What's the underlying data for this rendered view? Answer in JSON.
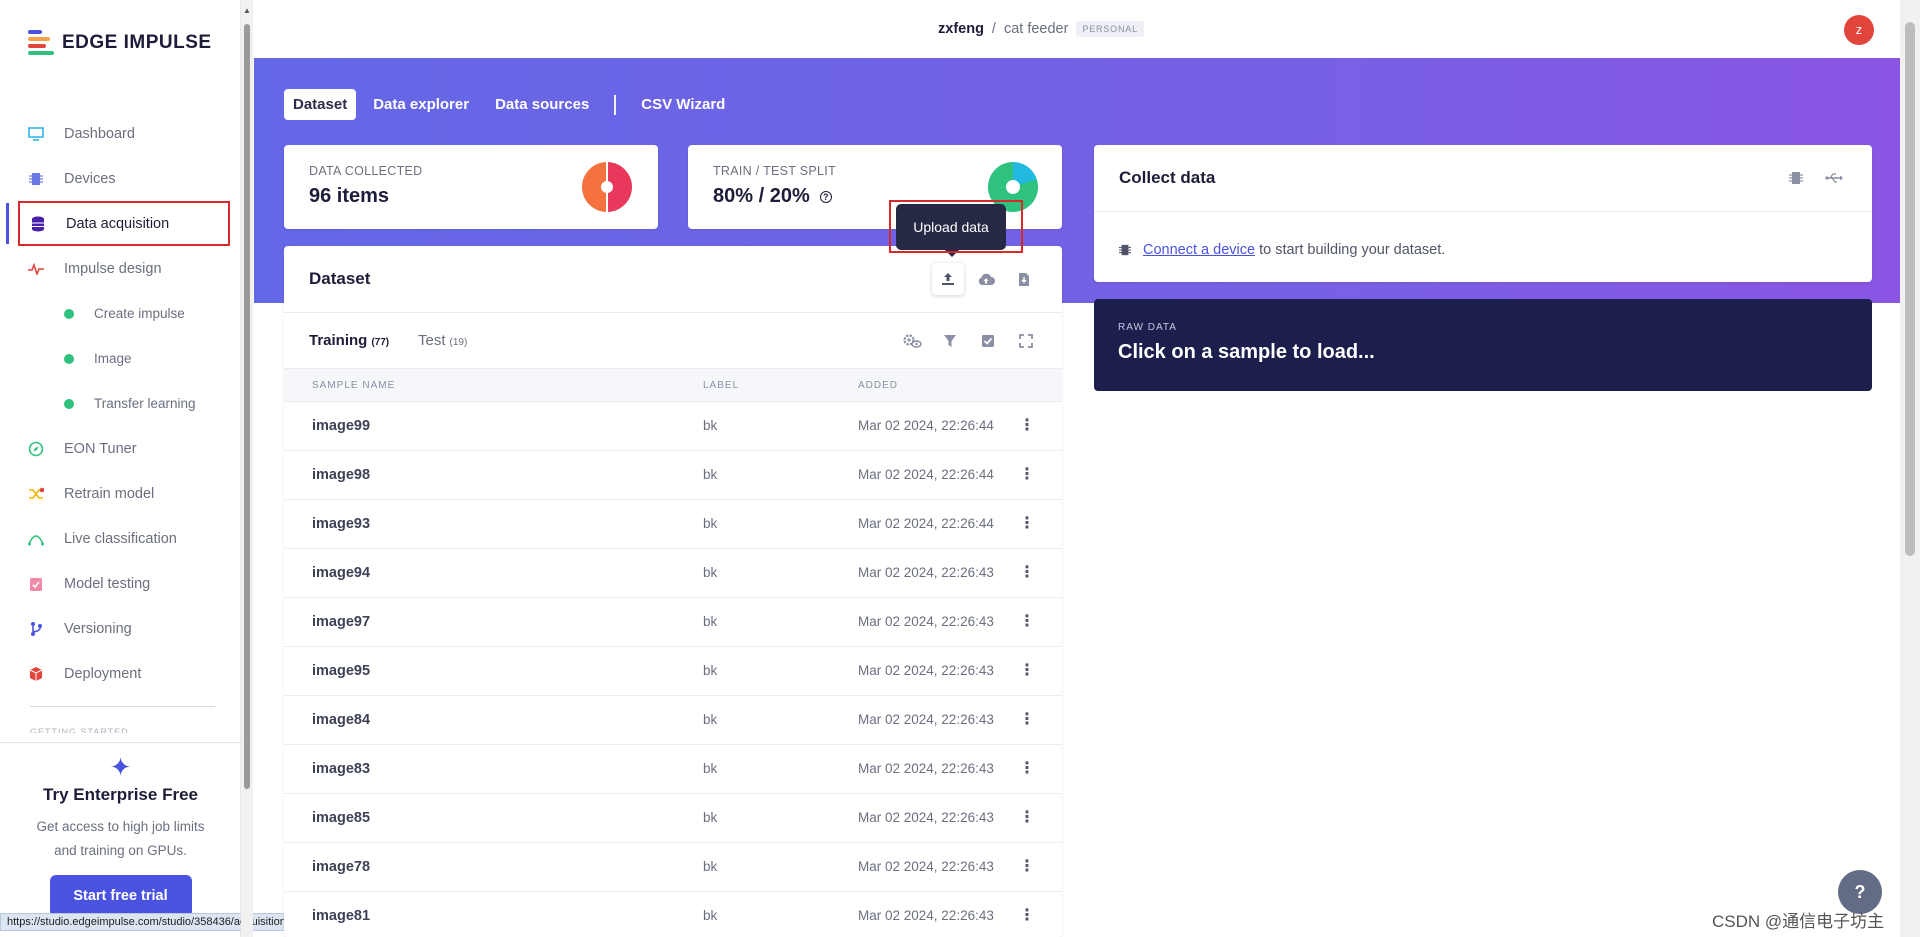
{
  "app": {
    "logo_text": "EDGE IMPULSE"
  },
  "sidebar": {
    "items": [
      {
        "label": "Dashboard",
        "icon": "monitor-icon"
      },
      {
        "label": "Devices",
        "icon": "chip-icon"
      },
      {
        "label": "Data acquisition",
        "icon": "database-icon",
        "active": true
      },
      {
        "label": "Impulse design",
        "icon": "pulse-icon"
      },
      {
        "label": "Create impulse",
        "sub": true
      },
      {
        "label": "Image",
        "sub": true
      },
      {
        "label": "Transfer learning",
        "sub": true
      },
      {
        "label": "EON Tuner",
        "icon": "compass-icon"
      },
      {
        "label": "Retrain model",
        "icon": "shuffle-icon"
      },
      {
        "label": "Live classification",
        "icon": "curve-icon"
      },
      {
        "label": "Model testing",
        "icon": "clipboard-icon"
      },
      {
        "label": "Versioning",
        "icon": "branch-icon"
      },
      {
        "label": "Deployment",
        "icon": "box-icon"
      }
    ],
    "section_label": "GETTING STARTED",
    "trial": {
      "title": "Try Enterprise Free",
      "desc_line1": "Get access to high job limits",
      "desc_line2": "and training on GPUs.",
      "button": "Start free trial"
    },
    "status_url": "https://studio.edgeimpulse.com/studio/358436/acquisition/training?page=1#"
  },
  "topbar": {
    "user": "zxfeng",
    "separator": "/",
    "project": "cat feeder",
    "badge": "PERSONAL",
    "avatar": "z"
  },
  "tabs": [
    "Dataset",
    "Data explorer",
    "Data sources",
    "CSV Wizard"
  ],
  "stats": {
    "collected": {
      "label": "DATA COLLECTED",
      "value": "96 items"
    },
    "split": {
      "label": "TRAIN / TEST SPLIT",
      "value": "80% / 20%"
    }
  },
  "tooltip": "Upload data",
  "dataset": {
    "title": "Dataset",
    "subtabs": [
      {
        "label": "Training",
        "count": "(77)"
      },
      {
        "label": "Test",
        "count": "(19)"
      }
    ],
    "columns": [
      "SAMPLE NAME",
      "LABEL",
      "ADDED"
    ],
    "rows": [
      {
        "name": "image99",
        "label": "bk",
        "added": "Mar 02 2024, 22:26:44"
      },
      {
        "name": "image98",
        "label": "bk",
        "added": "Mar 02 2024, 22:26:44"
      },
      {
        "name": "image93",
        "label": "bk",
        "added": "Mar 02 2024, 22:26:44"
      },
      {
        "name": "image94",
        "label": "bk",
        "added": "Mar 02 2024, 22:26:43"
      },
      {
        "name": "image97",
        "label": "bk",
        "added": "Mar 02 2024, 22:26:43"
      },
      {
        "name": "image95",
        "label": "bk",
        "added": "Mar 02 2024, 22:26:43"
      },
      {
        "name": "image84",
        "label": "bk",
        "added": "Mar 02 2024, 22:26:43"
      },
      {
        "name": "image83",
        "label": "bk",
        "added": "Mar 02 2024, 22:26:43"
      },
      {
        "name": "image85",
        "label": "bk",
        "added": "Mar 02 2024, 22:26:43"
      },
      {
        "name": "image78",
        "label": "bk",
        "added": "Mar 02 2024, 22:26:43"
      },
      {
        "name": "image81",
        "label": "bk",
        "added": "Mar 02 2024, 22:26:43"
      }
    ]
  },
  "collect": {
    "title": "Collect data",
    "link": "Connect a device",
    "text": "to start building your dataset."
  },
  "raw": {
    "label": "RAW DATA",
    "text": "Click on a sample to load..."
  },
  "watermark": "CSDN @通信电子坊主",
  "colors": {
    "accent": "#4a53e0",
    "banner_start": "#6368e7",
    "banner_end": "#8a55e3",
    "raw_bg": "#1c1f4b",
    "highlight": "#d62a2a"
  }
}
